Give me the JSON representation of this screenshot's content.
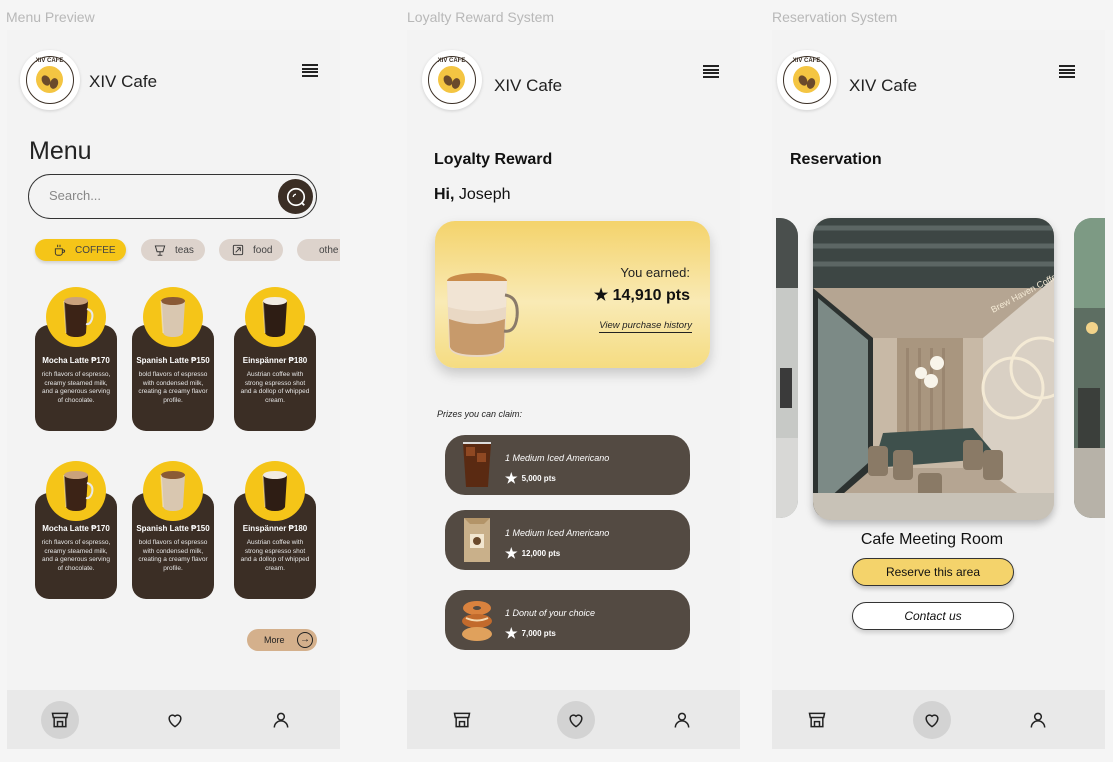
{
  "frames": {
    "menu_title": "Menu Preview",
    "loyalty_title": "Loyalty Reward System",
    "reservation_title": "Reservation System"
  },
  "brand": {
    "name": "XIV Cafe",
    "logo_text": "XIV CAFE"
  },
  "menu": {
    "heading": "Menu",
    "search_placeholder": "Search...",
    "categories": [
      {
        "label": "COFFEE",
        "icon": "coffee-cup-icon",
        "active": true
      },
      {
        "label": "teas",
        "icon": "tea-glass-icon",
        "active": false
      },
      {
        "label": "food",
        "icon": "food-icon",
        "active": false
      },
      {
        "label": "othe",
        "icon": "",
        "active": false
      }
    ],
    "products": [
      {
        "name": "Mocha Latte ₱170",
        "desc": "rich flavors of espresso, creamy steamed milk, and a generous serving of chocolate."
      },
      {
        "name": "Spanish Latte ₱150",
        "desc": "bold flavors of espresso with condensed milk, creating a creamy flavor profile."
      },
      {
        "name": "Einspänner ₱180",
        "desc": "Austrian coffee with strong espresso shot and a dollop of whipped cream."
      },
      {
        "name": "Mocha Latte ₱170",
        "desc": "rich flavors of espresso, creamy steamed milk, and a generous serving of chocolate."
      },
      {
        "name": "Spanish Latte ₱150",
        "desc": "bold flavors of espresso with condensed milk, creating a creamy flavor profile."
      },
      {
        "name": "Einspänner ₱180",
        "desc": "Austrian coffee with strong espresso shot and a dollop of whipped cream."
      }
    ],
    "more_label": "More"
  },
  "loyalty": {
    "heading": "Loyalty Reward",
    "greeting_prefix": "Hi,",
    "user_name": "Joseph",
    "earned_label": "You earned:",
    "points": "14,910 pts",
    "history_link": "View purchase history",
    "prizes_label": "Prizes you can claim:",
    "prizes": [
      {
        "title": "1 Medium Iced Americano",
        "pts": "5,000 pts"
      },
      {
        "title": "1 Medium Iced Americano",
        "pts": "12,000 pts"
      },
      {
        "title": "1 Donut of your choice",
        "pts": "7,000 pts"
      }
    ]
  },
  "reservation": {
    "heading": "Reservation",
    "room_name": "Cafe Meeting Room",
    "wall_sign": "Brew Haven Coffee Shop",
    "reserve_label": "Reserve this area",
    "contact_label": "Contact us"
  },
  "nav": {
    "items": [
      "store-icon",
      "heart-icon",
      "user-icon"
    ]
  },
  "colors": {
    "accent": "#f5c518",
    "dark": "#3b2e25",
    "prize_bg": "#534a42",
    "card_gold": "#f4d36b"
  }
}
